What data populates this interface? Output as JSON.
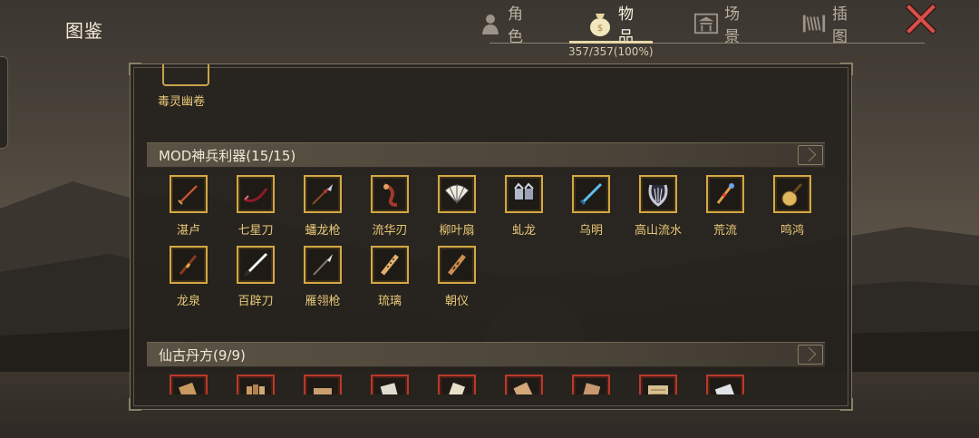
{
  "header": {
    "title": "图鉴",
    "tabs": [
      {
        "label": "角色",
        "icon": "character-icon",
        "active": false
      },
      {
        "label": "物品",
        "icon": "item-bag-icon",
        "active": true
      },
      {
        "label": "场景",
        "icon": "scene-pavilion-icon",
        "active": false
      },
      {
        "label": "插图",
        "icon": "illustration-scroll-icon",
        "active": false
      }
    ],
    "progress": "357/357(100%)",
    "close_icon": "close-x-icon"
  },
  "panel": {
    "previous_item": {
      "label": "毒灵幽卷"
    },
    "sections": [
      {
        "title": "MOD神兵利器(15/15)",
        "frame_color": "#d4a844",
        "items": [
          {
            "label": "湛卢",
            "icon": "sword-icon"
          },
          {
            "label": "七星刀",
            "icon": "curved-blade-icon"
          },
          {
            "label": "蟠龙枪",
            "icon": "spear-icon"
          },
          {
            "label": "流华刃",
            "icon": "ornate-blade-icon"
          },
          {
            "label": "柳叶扇",
            "icon": "fan-icon"
          },
          {
            "label": "虬龙",
            "icon": "gauntlet-icon"
          },
          {
            "label": "乌明",
            "icon": "blue-sword-icon"
          },
          {
            "label": "高山流水",
            "icon": "lyre-icon"
          },
          {
            "label": "荒流",
            "icon": "jeweled-staff-icon"
          },
          {
            "label": "鸣鸿",
            "icon": "pipa-icon"
          },
          {
            "label": "龙泉",
            "icon": "sword-icon"
          },
          {
            "label": "百辟刀",
            "icon": "saber-icon"
          },
          {
            "label": "雁翎枪",
            "icon": "spear-icon"
          },
          {
            "label": "琉璃",
            "icon": "flute-icon"
          },
          {
            "label": "朝仪",
            "icon": "flute-icon"
          }
        ]
      },
      {
        "title": "仙古丹方(9/9)",
        "frame_color": "#b83a2a",
        "items": [
          {
            "label": "",
            "icon": "scroll-icon"
          },
          {
            "label": "",
            "icon": "scroll-bundle-icon"
          },
          {
            "label": "",
            "icon": "scroll-icon"
          },
          {
            "label": "",
            "icon": "scroll-icon"
          },
          {
            "label": "",
            "icon": "scroll-icon"
          },
          {
            "label": "",
            "icon": "scroll-icon"
          },
          {
            "label": "",
            "icon": "scroll-icon"
          },
          {
            "label": "",
            "icon": "map-scroll-icon"
          },
          {
            "label": "",
            "icon": "scroll-icon"
          }
        ]
      }
    ]
  }
}
